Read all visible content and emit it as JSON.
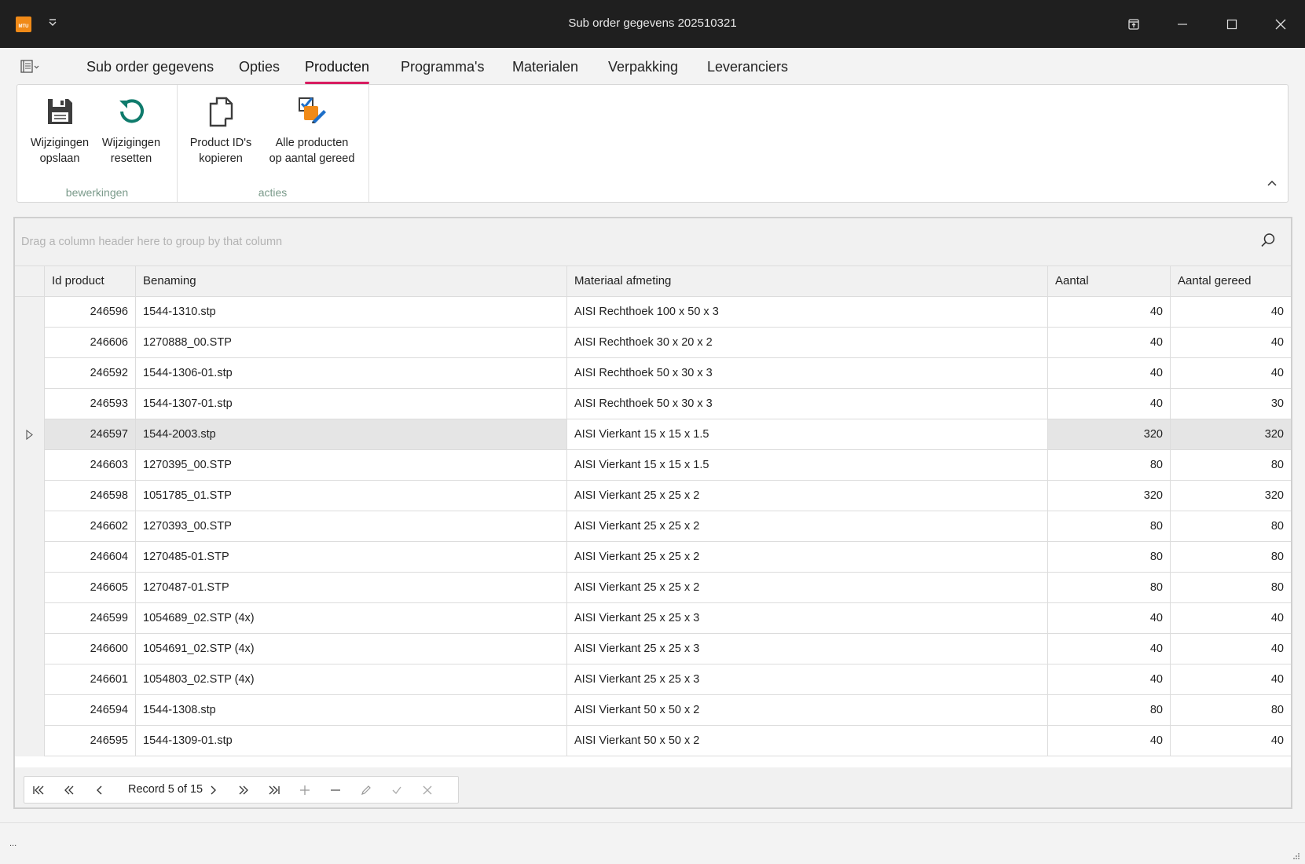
{
  "window": {
    "title": "Sub order gegevens 202510321",
    "logo_text": "MTU"
  },
  "ribbon": {
    "tabs": [
      {
        "label": "Sub order gegevens"
      },
      {
        "label": "Opties"
      },
      {
        "label": "Producten",
        "active": true
      },
      {
        "label": "Programma's"
      },
      {
        "label": "Materialen"
      },
      {
        "label": "Verpakking"
      },
      {
        "label": "Leveranciers"
      }
    ],
    "groups": [
      {
        "label": "bewerkingen",
        "buttons": [
          {
            "line1": "Wijzigingen",
            "line2": "opslaan",
            "icon": "save-icon"
          },
          {
            "line1": "Wijzigingen",
            "line2": "resetten",
            "icon": "reset-icon"
          }
        ]
      },
      {
        "label": "acties",
        "buttons": [
          {
            "line1": "Product ID's",
            "line2": "kopieren",
            "icon": "copy-icon"
          },
          {
            "line1": "Alle producten",
            "line2": "op aantal gereed",
            "icon": "checklist-edit-icon"
          }
        ]
      }
    ]
  },
  "grid": {
    "group_hint": "Drag a column header here to group by that column",
    "columns": [
      "Id product",
      "Benaming",
      "Materiaal afmeting",
      "Aantal",
      "Aantal gereed"
    ],
    "selected_row_index": 4,
    "rows": [
      {
        "id": "246596",
        "name": "1544-1310.stp",
        "material": "AISI Rechthoek 100 x 50 x 3",
        "qty": "40",
        "done": "40"
      },
      {
        "id": "246606",
        "name": "1270888_00.STP",
        "material": "AISI Rechthoek 30 x 20 x 2",
        "qty": "40",
        "done": "40"
      },
      {
        "id": "246592",
        "name": "1544-1306-01.stp",
        "material": "AISI Rechthoek 50 x 30 x 3",
        "qty": "40",
        "done": "40"
      },
      {
        "id": "246593",
        "name": "1544-1307-01.stp",
        "material": "AISI Rechthoek 50 x 30 x 3",
        "qty": "40",
        "done": "30"
      },
      {
        "id": "246597",
        "name": "1544-2003.stp",
        "material": "AISI Vierkant 15 x 15 x 1.5",
        "qty": "320",
        "done": "320"
      },
      {
        "id": "246603",
        "name": "1270395_00.STP",
        "material": "AISI Vierkant 15 x 15 x 1.5",
        "qty": "80",
        "done": "80"
      },
      {
        "id": "246598",
        "name": "1051785_01.STP",
        "material": "AISI Vierkant 25 x 25 x 2",
        "qty": "320",
        "done": "320"
      },
      {
        "id": "246602",
        "name": "1270393_00.STP",
        "material": "AISI Vierkant 25 x 25 x 2",
        "qty": "80",
        "done": "80"
      },
      {
        "id": "246604",
        "name": "1270485-01.STP",
        "material": "AISI Vierkant 25 x 25 x 2",
        "qty": "80",
        "done": "80"
      },
      {
        "id": "246605",
        "name": "1270487-01.STP",
        "material": "AISI Vierkant 25 x 25 x 2",
        "qty": "80",
        "done": "80"
      },
      {
        "id": "246599",
        "name": "1054689_02.STP (4x)",
        "material": "AISI Vierkant 25 x 25 x 3",
        "qty": "40",
        "done": "40"
      },
      {
        "id": "246600",
        "name": "1054691_02.STP (4x)",
        "material": "AISI Vierkant 25 x 25 x 3",
        "qty": "40",
        "done": "40"
      },
      {
        "id": "246601",
        "name": "1054803_02.STP (4x)",
        "material": "AISI Vierkant 25 x 25 x 3",
        "qty": "40",
        "done": "40"
      },
      {
        "id": "246594",
        "name": "1544-1308.stp",
        "material": "AISI Vierkant 50 x 50 x 2",
        "qty": "80",
        "done": "80"
      },
      {
        "id": "246595",
        "name": "1544-1309-01.stp",
        "material": "AISI Vierkant 50 x 50 x 2",
        "qty": "40",
        "done": "40"
      }
    ]
  },
  "navigator": {
    "record_text": "Record 5 of 15",
    "buttons": [
      "first-icon",
      "prev-page-icon",
      "prev-icon",
      "next-icon",
      "next-page-icon",
      "last-icon",
      "add-icon",
      "remove-icon",
      "edit-icon",
      "accept-icon",
      "cancel-icon"
    ]
  },
  "statusbar": {
    "text": "..."
  },
  "colors": {
    "accent": "#d81b60",
    "logo": "#f08a18",
    "titlebar": "#1f1f1f",
    "reset_icon": "#0f7b6c"
  }
}
